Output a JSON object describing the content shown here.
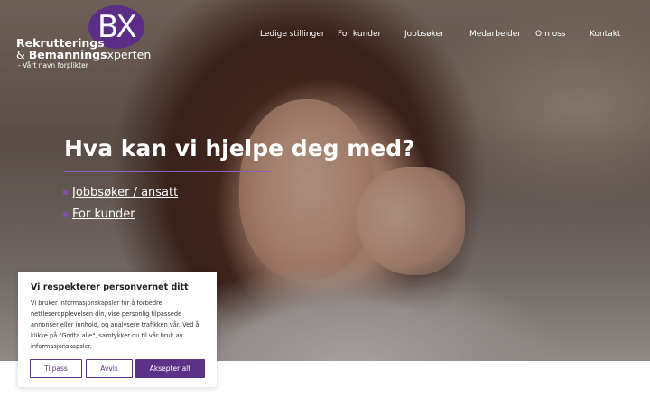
{
  "header": {
    "logo": {
      "mark": "BX",
      "line1": "Rekrutterings",
      "line2_prefix": "& ",
      "line2_bold": "Bemannings",
      "line2_suffix": "xperten",
      "tagline": "- Vårt navn forplikter"
    },
    "nav": [
      {
        "label": "Ledige stillinger"
      },
      {
        "label": "For kunder"
      },
      {
        "label": "Jobbsøker"
      },
      {
        "label": "Medarbeider"
      },
      {
        "label": "Om oss"
      },
      {
        "label": "Kontakt"
      }
    ]
  },
  "hero": {
    "headline": "Hva kan vi hjelpe deg med?",
    "links": [
      {
        "label": "Jobbsøker / ansatt"
      },
      {
        "label": "For kunder"
      }
    ]
  },
  "cookie": {
    "title": "Vi respekterer personvernet ditt",
    "text": "Vi bruker informasjonskapsler for å forbedre nettleseropplevelsen din, vise personlig tilpassede annonser eller innhold, og analysere trafikken vår. Ved å klikke på \"Godta alle\", samtykker du til vår bruk av informasjonskapsler.",
    "buttons": {
      "customize": "Tilpass",
      "reject": "Avvis",
      "accept": "Aksepter alt"
    }
  },
  "colors": {
    "brand_purple": "#5b2d87",
    "accent_purple": "#8a64b8"
  }
}
